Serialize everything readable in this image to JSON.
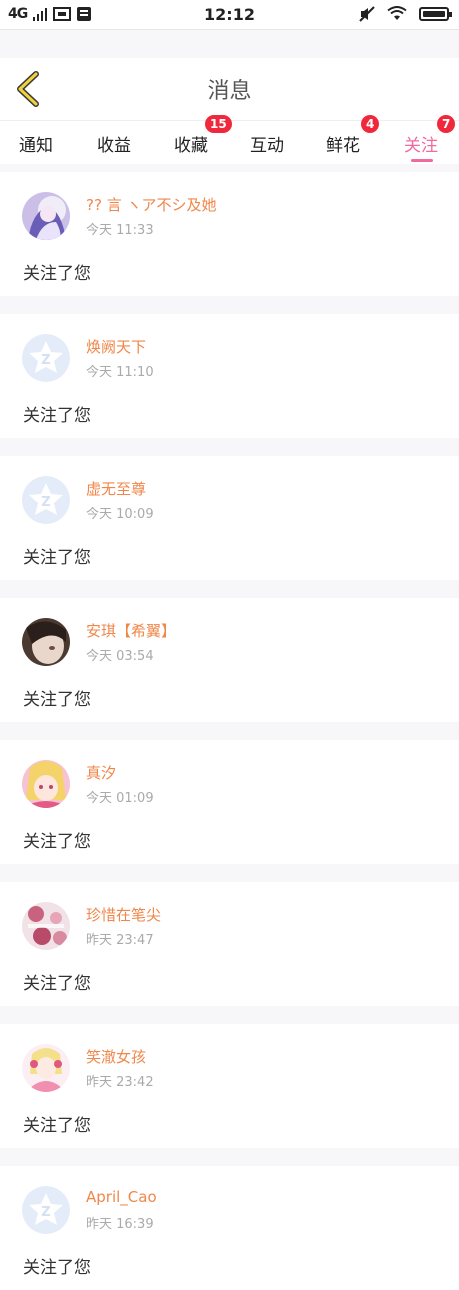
{
  "status_bar": {
    "network": "4G",
    "time": "12:12"
  },
  "header": {
    "title": "消息",
    "back_icon": "chevron-left-icon"
  },
  "tabs": [
    {
      "label": "通知",
      "badge": ""
    },
    {
      "label": "收益",
      "badge": ""
    },
    {
      "label": "收藏",
      "badge": "15"
    },
    {
      "label": "互动",
      "badge": ""
    },
    {
      "label": "鲜花",
      "badge": "4"
    },
    {
      "label": "关注",
      "badge": "7",
      "active": true
    }
  ],
  "colors": {
    "accent": "#f06aa0",
    "name": "#f0874a",
    "badge": "#f0283c"
  },
  "messages": [
    {
      "name": "?? 言 ヽア不シ及她",
      "time": "今天 11:33",
      "text": "关注了您",
      "avatar": "anime-girl-avatar"
    },
    {
      "name": "焕阙天下",
      "time": "今天 11:10",
      "text": "关注了您",
      "avatar": "default-avatar"
    },
    {
      "name": "虚无至尊",
      "time": "今天 10:09",
      "text": "关注了您",
      "avatar": "default-avatar"
    },
    {
      "name": "安琪【希翼】",
      "time": "今天 03:54",
      "text": "关注了您",
      "avatar": "photo-avatar"
    },
    {
      "name": "真汐",
      "time": "今天 01:09",
      "text": "关注了您",
      "avatar": "anime-pink-avatar"
    },
    {
      "name": "珍惜在笔尖",
      "time": "昨天 23:47",
      "text": "关注了您",
      "avatar": "floral-avatar"
    },
    {
      "name": "笑澈女孩",
      "time": "昨天 23:42",
      "text": "关注了您",
      "avatar": "anime-doll-avatar"
    },
    {
      "name": "April_Cao",
      "time": "昨天 16:39",
      "text": "关注了您",
      "avatar": "default-avatar"
    }
  ]
}
